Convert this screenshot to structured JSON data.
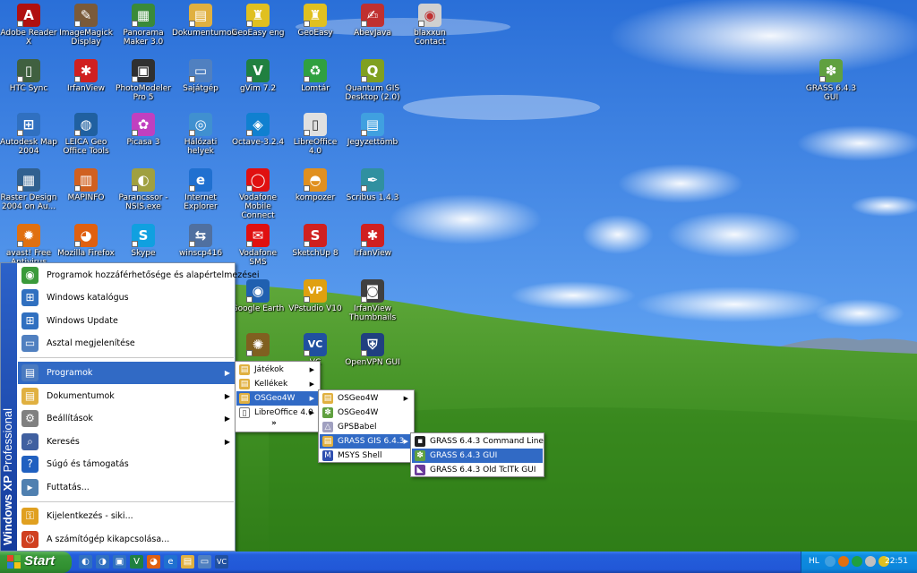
{
  "desktop_icons": [
    {
      "label": "Adobe Reader X",
      "icon": "adobe-reader-icon",
      "color": "#b01010",
      "glyph": "A"
    },
    {
      "label": "ImageMagick Display",
      "icon": "imagemagick-icon",
      "color": "#7a5a3a",
      "glyph": "✎"
    },
    {
      "label": "Panorama Maker 3.0",
      "icon": "panorama-maker-icon",
      "color": "#3a8a3a",
      "glyph": "▦"
    },
    {
      "label": "Dokumentumok",
      "icon": "my-documents-icon",
      "color": "#e0b040",
      "glyph": "▤"
    },
    {
      "label": "GeoEasy eng",
      "icon": "geoeasy-icon",
      "color": "#e0c020",
      "glyph": "♜"
    },
    {
      "label": "GeoEasy",
      "icon": "geoeasy-icon",
      "color": "#e0c020",
      "glyph": "♜"
    },
    {
      "label": "AbevJava",
      "icon": "abevjava-icon",
      "color": "#c03030",
      "glyph": "✍"
    },
    {
      "label": "blaxxun Contact",
      "icon": "blaxxun-icon",
      "color": "#d0d0d0",
      "glyph": "◉"
    },
    {
      "label": "HTC Sync",
      "icon": "htc-sync-icon",
      "color": "#406040",
      "glyph": "▯"
    },
    {
      "label": "IrfanView",
      "icon": "irfanview-icon",
      "color": "#d02020",
      "glyph": "✱"
    },
    {
      "label": "PhotoModeler Pro 5",
      "icon": "photomodeler-icon",
      "color": "#303030",
      "glyph": "▣"
    },
    {
      "label": "Sajátgép",
      "icon": "my-computer-icon",
      "color": "#5080c0",
      "glyph": "▭"
    },
    {
      "label": "gVim 7.2",
      "icon": "gvim-icon",
      "color": "#208040",
      "glyph": "V"
    },
    {
      "label": "Lomtár",
      "icon": "recycle-bin-icon",
      "color": "#30a040",
      "glyph": "♻"
    },
    {
      "label": "Quantum GIS Desktop (2.0)",
      "icon": "qgis-icon",
      "color": "#80a020",
      "glyph": "Q"
    },
    {
      "label": "Autodesk Map 2004",
      "icon": "autodesk-map-icon",
      "color": "#3070c0",
      "glyph": "⊞"
    },
    {
      "label": "LEICA Geo Office Tools",
      "icon": "leica-geo-icon",
      "color": "#2060a0",
      "glyph": "◍"
    },
    {
      "label": "Picasa 3",
      "icon": "picasa-icon",
      "color": "#c040c0",
      "glyph": "✿"
    },
    {
      "label": "Hálózati helyek",
      "icon": "network-places-icon",
      "color": "#4090d0",
      "glyph": "◎"
    },
    {
      "label": "Octave-3.2.4",
      "icon": "octave-icon",
      "color": "#1080d0",
      "glyph": "◈"
    },
    {
      "label": "LibreOffice 4.0",
      "icon": "libreoffice-icon",
      "color": "#e0e0e0",
      "glyph": "▯"
    },
    {
      "label": "Jegyzettömb",
      "icon": "notepad-icon",
      "color": "#40a0e0",
      "glyph": "▤"
    },
    {
      "label": "Raster Design 2004 on Au...",
      "icon": "raster-design-icon",
      "color": "#306090",
      "glyph": "▦"
    },
    {
      "label": "MAPINFO",
      "icon": "mapinfo-icon",
      "color": "#d06020",
      "glyph": "▥"
    },
    {
      "label": "Parancssor - NSIS.exe",
      "icon": "nsis-icon",
      "color": "#a0a040",
      "glyph": "◐"
    },
    {
      "label": "Internet Explorer",
      "icon": "internet-explorer-icon",
      "color": "#2070d0",
      "glyph": "e"
    },
    {
      "label": "Vodafone Mobile Connect",
      "icon": "vodafone-icon",
      "color": "#e01010",
      "glyph": "◯"
    },
    {
      "label": "kompozer",
      "icon": "kompozer-icon",
      "color": "#e09020",
      "glyph": "◓"
    },
    {
      "label": "Scribus 1.4.3",
      "icon": "scribus-icon",
      "color": "#3090a0",
      "glyph": "✒"
    },
    {
      "label": "avast! Free Antivirus",
      "icon": "avast-icon",
      "color": "#e07010",
      "glyph": "✹"
    },
    {
      "label": "Mozilla Firefox",
      "icon": "firefox-icon",
      "color": "#e06010",
      "glyph": "◕"
    },
    {
      "label": "Skype",
      "icon": "skype-icon",
      "color": "#10a0e0",
      "glyph": "S"
    },
    {
      "label": "winscp416",
      "icon": "winscp-icon",
      "color": "#5070a0",
      "glyph": "⇆"
    },
    {
      "label": "Vodafone SMS",
      "icon": "vodafone-sms-icon",
      "color": "#e01010",
      "glyph": "✉"
    },
    {
      "label": "SketchUp 8",
      "icon": "sketchup-icon",
      "color": "#d02020",
      "glyph": "S"
    },
    {
      "label": "IrfanView",
      "icon": "irfanview-icon",
      "color": "#d02020",
      "glyph": "✱"
    },
    {
      "label": "Google Earth",
      "icon": "google-earth-icon",
      "color": "#2060b0",
      "glyph": "◉"
    },
    {
      "label": "VPstudio V10",
      "icon": "vpstudio-icon",
      "color": "#e0a010",
      "glyph": "VP"
    },
    {
      "label": "IrfanView Thumbnails",
      "icon": "irfanview-thumbnails-icon",
      "color": "#404040",
      "glyph": "◙"
    },
    {
      "label": "",
      "icon": "grass-gis-icon",
      "color": "#806020",
      "glyph": "✺"
    },
    {
      "label": "VC",
      "icon": "vc-icon",
      "color": "#2050a0",
      "glyph": "VC"
    },
    {
      "label": "OpenVPN GUI",
      "icon": "openvpn-icon",
      "color": "#204080",
      "glyph": "⛨"
    },
    {
      "label": "GRASS 6.4.3 GUI",
      "icon": "grass-gui-icon",
      "color": "#60a040",
      "glyph": "✽"
    }
  ],
  "start_menu": {
    "side_text_brand": "Windows XP",
    "side_text_edition": "Professional",
    "items": [
      {
        "label": "Programok hozzáférhetősége és alapértelmezései",
        "icon": "program-access-icon",
        "color": "#3a9a3a",
        "glyph": "◉"
      },
      {
        "label": "Windows katalógus",
        "icon": "windows-catalog-icon",
        "color": "#3070c0",
        "glyph": "⊞"
      },
      {
        "label": "Windows Update",
        "icon": "windows-update-icon",
        "color": "#3070c0",
        "glyph": "⊞"
      },
      {
        "label": "Asztal megjelenítése",
        "icon": "show-desktop-icon",
        "color": "#5080c0",
        "glyph": "▭"
      },
      {
        "label": "Programok",
        "icon": "programs-icon",
        "color": "#4a7ac0",
        "glyph": "▤"
      },
      {
        "label": "Dokumentumok",
        "icon": "documents-icon",
        "color": "#e0b040",
        "glyph": "▤"
      },
      {
        "label": "Beállítások",
        "icon": "settings-icon",
        "color": "#808080",
        "glyph": "⚙"
      },
      {
        "label": "Keresés",
        "icon": "search-icon",
        "color": "#4060a0",
        "glyph": "⌕"
      },
      {
        "label": "Súgó és támogatás",
        "icon": "help-icon",
        "color": "#2060c0",
        "glyph": "?"
      },
      {
        "label": "Futtatás...",
        "icon": "run-icon",
        "color": "#5080b0",
        "glyph": "▸"
      },
      {
        "label": "Kijelentkezés - siki...",
        "icon": "logoff-icon",
        "color": "#e0a020",
        "glyph": "⚿"
      },
      {
        "label": "A számítógép kikapcsolása...",
        "icon": "shutdown-icon",
        "color": "#d04020",
        "glyph": "⏻"
      }
    ]
  },
  "programs_menu": {
    "items": [
      {
        "label": "Játékok",
        "icon": "folder-icon"
      },
      {
        "label": "Kellékek",
        "icon": "folder-icon"
      },
      {
        "label": "OSGeo4W",
        "icon": "folder-icon"
      },
      {
        "label": "LibreOffice 4.0",
        "icon": "document-icon"
      }
    ],
    "expand_glyph": "»"
  },
  "osgeo_menu": {
    "items": [
      {
        "label": "OSGeo4W",
        "icon": "folder-icon"
      },
      {
        "label": "OSGeo4W",
        "icon": "osgeo-icon"
      },
      {
        "label": "GPSBabel",
        "icon": "gpsbabel-icon"
      },
      {
        "label": "GRASS GIS 6.4.3",
        "icon": "folder-icon"
      },
      {
        "label": "MSYS Shell",
        "icon": "msys-icon"
      }
    ]
  },
  "grass_menu": {
    "items": [
      {
        "label": "GRASS 6.4.3 Command Line",
        "icon": "command-line-icon"
      },
      {
        "label": "GRASS 6.4.3 GUI",
        "icon": "grass-gui-icon"
      },
      {
        "label": "GRASS 6.4.3 Old TclTk GUI",
        "icon": "grass-tcltk-icon"
      }
    ]
  },
  "taskbar": {
    "start_label": "Start",
    "quicklaunch": [
      {
        "icon": "quicklaunch-icon",
        "color": "#3070c0",
        "glyph": "◐"
      },
      {
        "icon": "quicklaunch-icon",
        "color": "#3070c0",
        "glyph": "◑"
      },
      {
        "icon": "quicklaunch-icon",
        "color": "#3070c0",
        "glyph": "▣"
      },
      {
        "icon": "gvim-icon",
        "color": "#208040",
        "glyph": "V"
      },
      {
        "icon": "firefox-icon",
        "color": "#e06010",
        "glyph": "◕"
      },
      {
        "icon": "internet-explorer-icon",
        "color": "#2070d0",
        "glyph": "e"
      },
      {
        "icon": "folder-icon",
        "color": "#e0b040",
        "glyph": "▤"
      },
      {
        "icon": "quicklaunch-icon",
        "color": "#5080c0",
        "glyph": "▭"
      },
      {
        "icon": "quicklaunch-icon",
        "color": "#c02020",
        "glyph": "◈"
      },
      {
        "icon": "quicklaunch-icon",
        "color": "#2060c0",
        "glyph": "▥"
      },
      {
        "icon": "vpstudio-icon",
        "color": "#e0a010",
        "glyph": "V"
      },
      {
        "icon": "vc-icon",
        "color": "#2050a0",
        "glyph": "VC"
      }
    ],
    "tray_lang": "HL",
    "clock": "22:51",
    "tray_icons": [
      {
        "icon": "network-icon",
        "color": "#40a0e0"
      },
      {
        "icon": "antivirus-icon",
        "color": "#e07010"
      },
      {
        "icon": "update-icon",
        "color": "#20a040"
      },
      {
        "icon": "volume-icon",
        "color": "#c0c0c0"
      },
      {
        "icon": "security-icon",
        "color": "#e0c020"
      }
    ]
  }
}
